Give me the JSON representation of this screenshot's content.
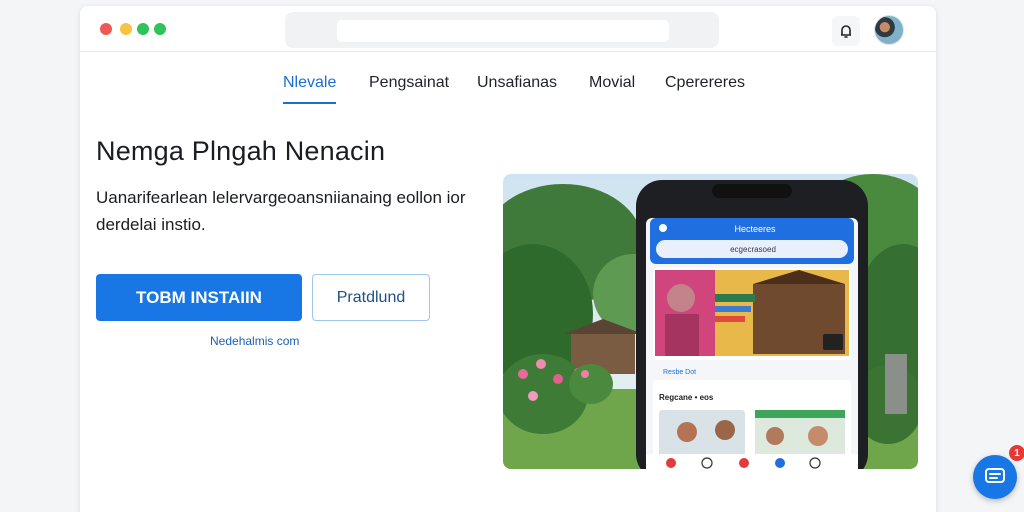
{
  "browser": {
    "window_controls": [
      "red",
      "yellow",
      "green",
      "green"
    ],
    "colors": {
      "red": "#ee5a52",
      "yellow": "#f6c343",
      "green": "#2ec45b"
    },
    "bell_icon": "bell-icon",
    "avatar_icon": "user-avatar"
  },
  "nav": {
    "items": [
      {
        "label": "Nlevale",
        "active": true
      },
      {
        "label": "Pengsainat",
        "active": false
      },
      {
        "label": "Unsafianas",
        "active": false
      },
      {
        "label": "Movial",
        "active": false
      },
      {
        "label": "Cperereres",
        "active": false
      }
    ]
  },
  "hero": {
    "title": "Nemga Plngah Nenacin",
    "description": "Uanarifearlean lelervargeoansniianaing eollon ior derdelai instio.",
    "primary_button": "TOBM INSTAIIN",
    "secondary_button": "Pratdlund",
    "link": "Nedehalmis com"
  },
  "phone": {
    "header_title": "Hecteeres",
    "search_text": "ecgecrasoed",
    "section_label": "Regcane • eos",
    "tag_label": "Resbe Dot"
  },
  "chat": {
    "icon": "chat-icon",
    "badge": "1",
    "accent": "#1877e5"
  }
}
